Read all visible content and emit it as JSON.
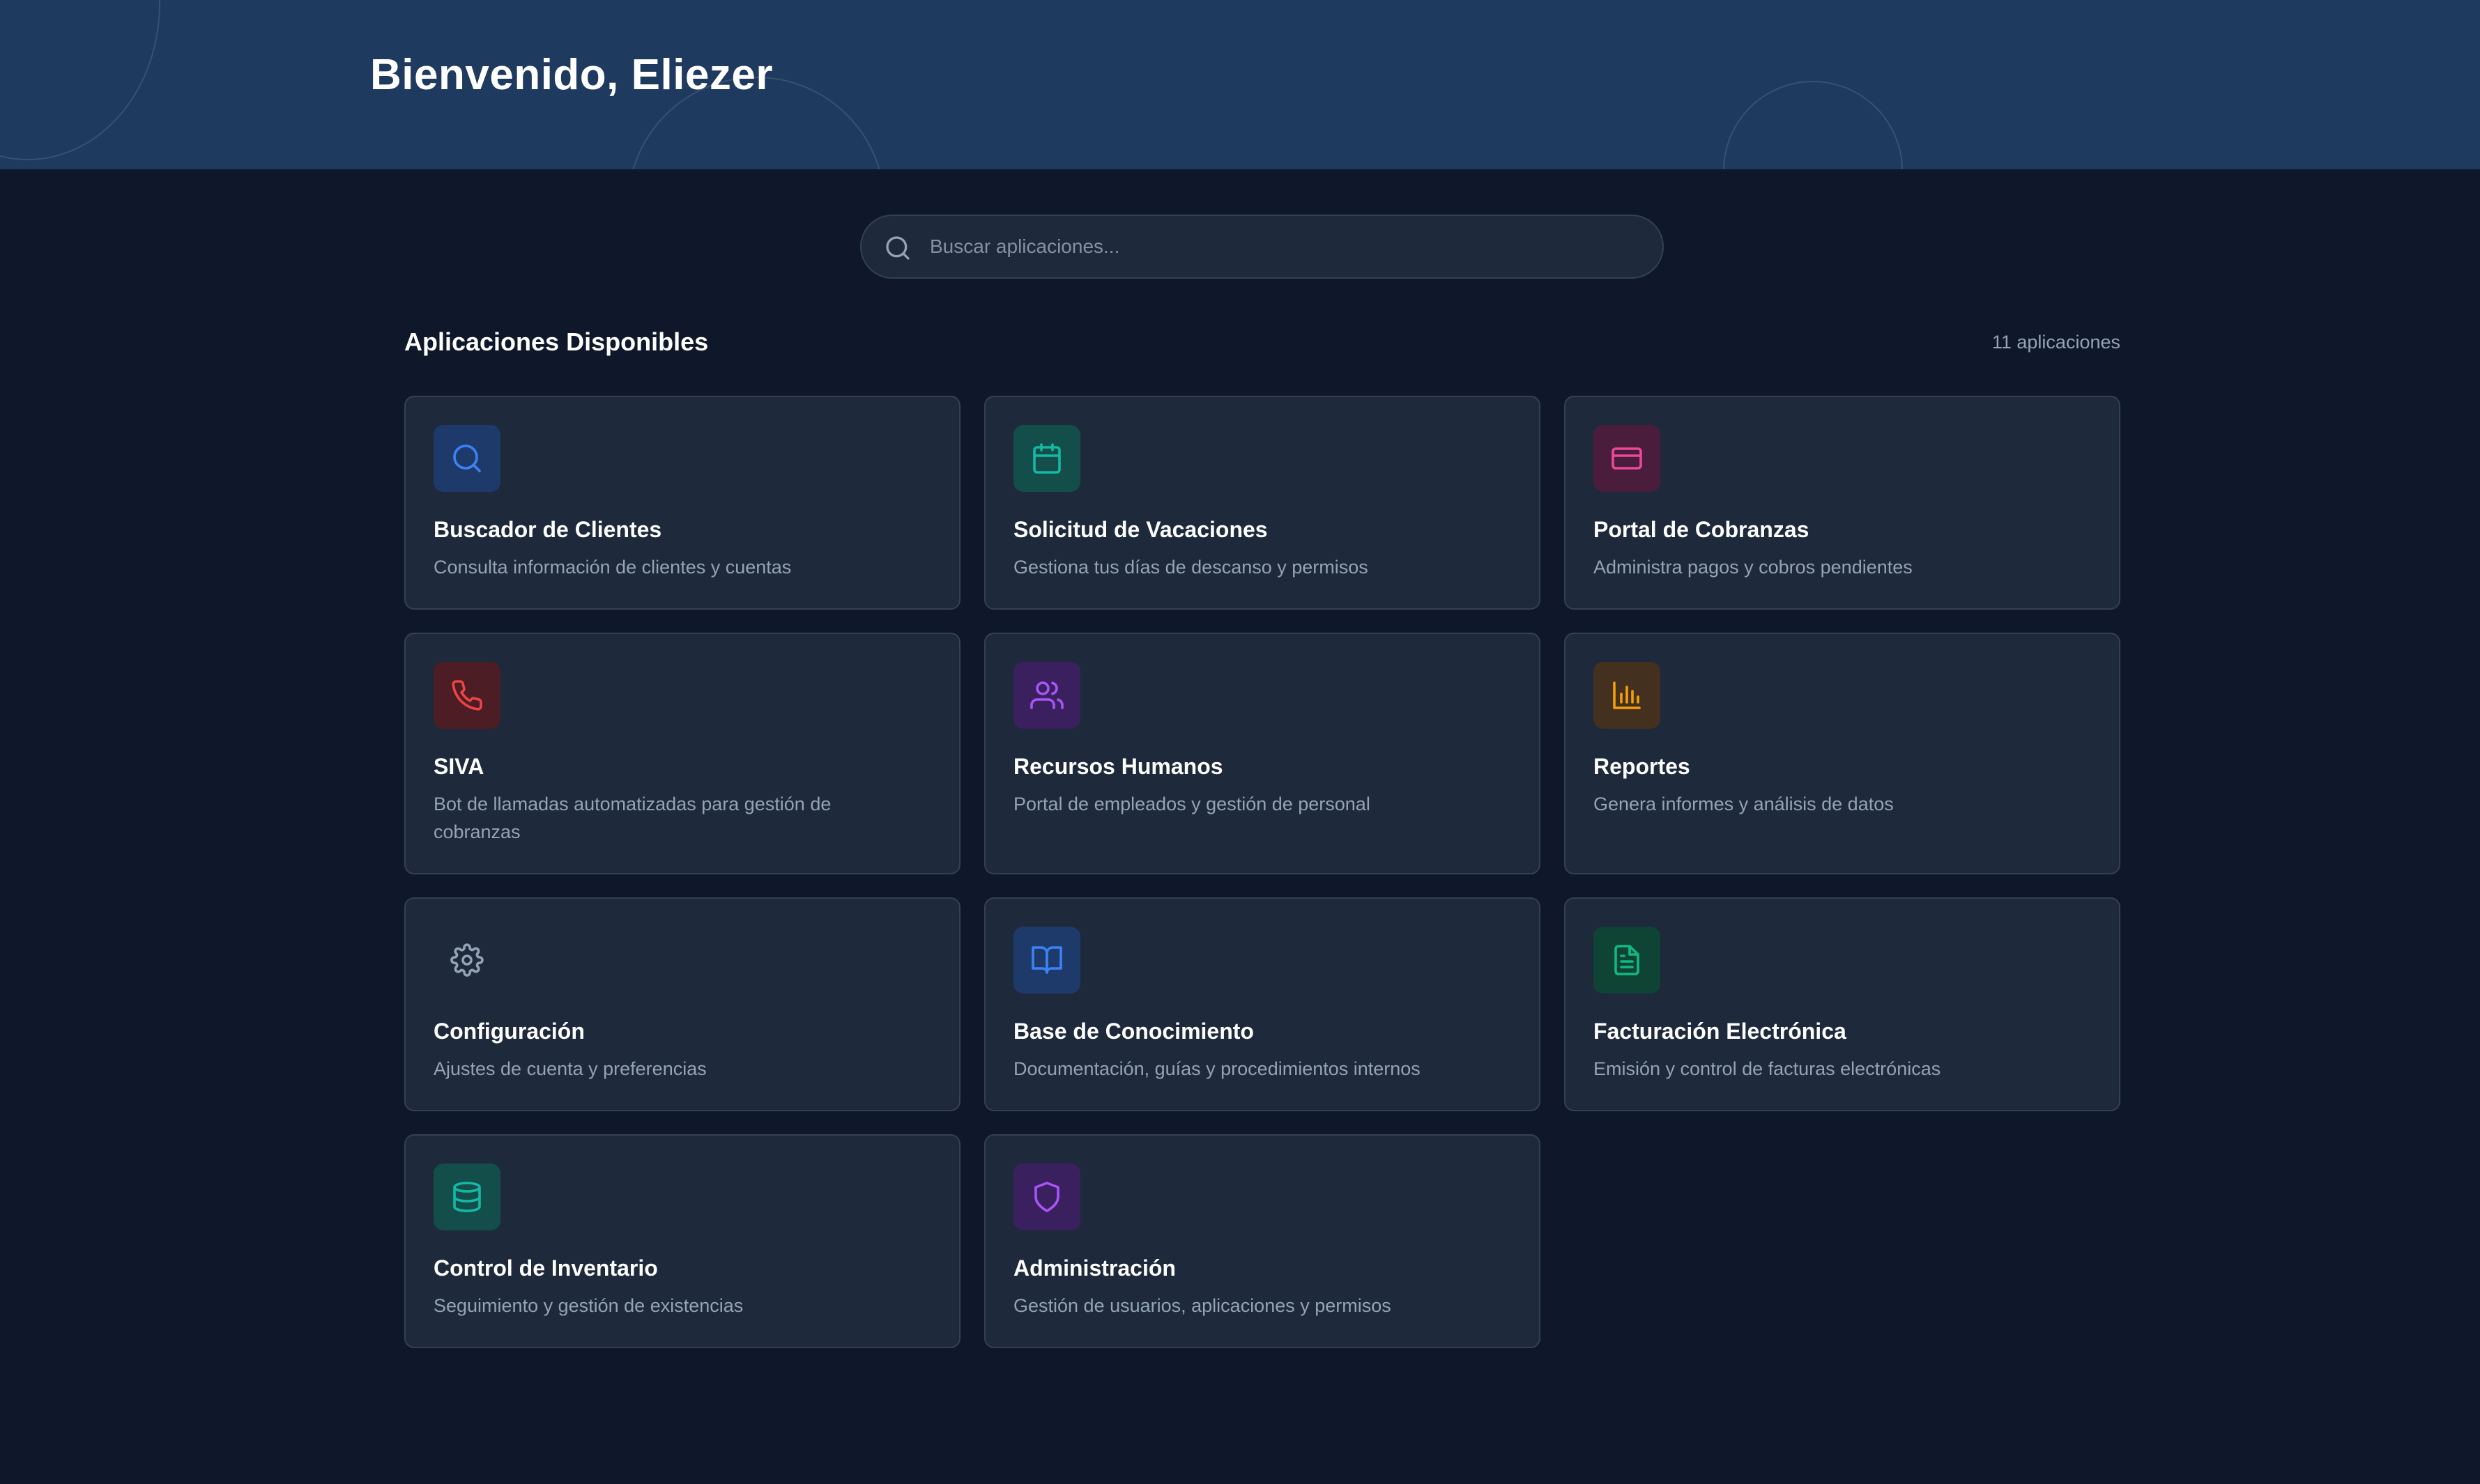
{
  "header": {
    "greeting": "Bienvenido, Eliezer"
  },
  "search": {
    "placeholder": "Buscar aplicaciones...",
    "value": ""
  },
  "section": {
    "title": "Aplicaciones Disponibles",
    "count": "11 aplicaciones"
  },
  "apps": [
    {
      "title": "Buscador de Clientes",
      "description": "Consulta información de clientes y cuentas",
      "icon": "search-icon",
      "color": "#3b82f6",
      "bg": "#1e3a6b"
    },
    {
      "title": "Solicitud de Vacaciones",
      "description": "Gestiona tus días de descanso y permisos",
      "icon": "calendar-icon",
      "color": "#14b8a6",
      "bg": "#134e4a"
    },
    {
      "title": "Portal de Cobranzas",
      "description": "Administra pagos y cobros pendientes",
      "icon": "credit-card-icon",
      "color": "#ec4899",
      "bg": "#4a1d3c"
    },
    {
      "title": "SIVA",
      "description": "Bot de llamadas automatizadas para gestión de cobranzas",
      "icon": "phone-icon",
      "color": "#ef4444",
      "bg": "#4c1d24"
    },
    {
      "title": "Recursos Humanos",
      "description": "Portal de empleados y gestión de personal",
      "icon": "users-icon",
      "color": "#a855f7",
      "bg": "#3b2060"
    },
    {
      "title": "Reportes",
      "description": "Genera informes y análisis de datos",
      "icon": "bar-chart-icon",
      "color": "#f59e0b",
      "bg": "#43301e"
    },
    {
      "title": "Configuración",
      "description": "Ajustes de cuenta y preferencias",
      "icon": "gear-icon",
      "color": "#94a3b8",
      "bg": "#1e293b"
    },
    {
      "title": "Base de Conocimiento",
      "description": "Documentación, guías y procedimientos internos",
      "icon": "book-open-icon",
      "color": "#3b82f6",
      "bg": "#1e3a6b"
    },
    {
      "title": "Facturación Electrónica",
      "description": "Emisión y control de facturas electrónicas",
      "icon": "file-text-icon",
      "color": "#10b981",
      "bg": "#0f4434"
    },
    {
      "title": "Control de Inventario",
      "description": "Seguimiento y gestión de existencias",
      "icon": "database-icon",
      "color": "#14b8a6",
      "bg": "#134e4a"
    },
    {
      "title": "Administración",
      "description": "Gestión de usuarios, aplicaciones y permisos",
      "icon": "shield-icon",
      "color": "#a855f7",
      "bg": "#3b2060"
    }
  ]
}
